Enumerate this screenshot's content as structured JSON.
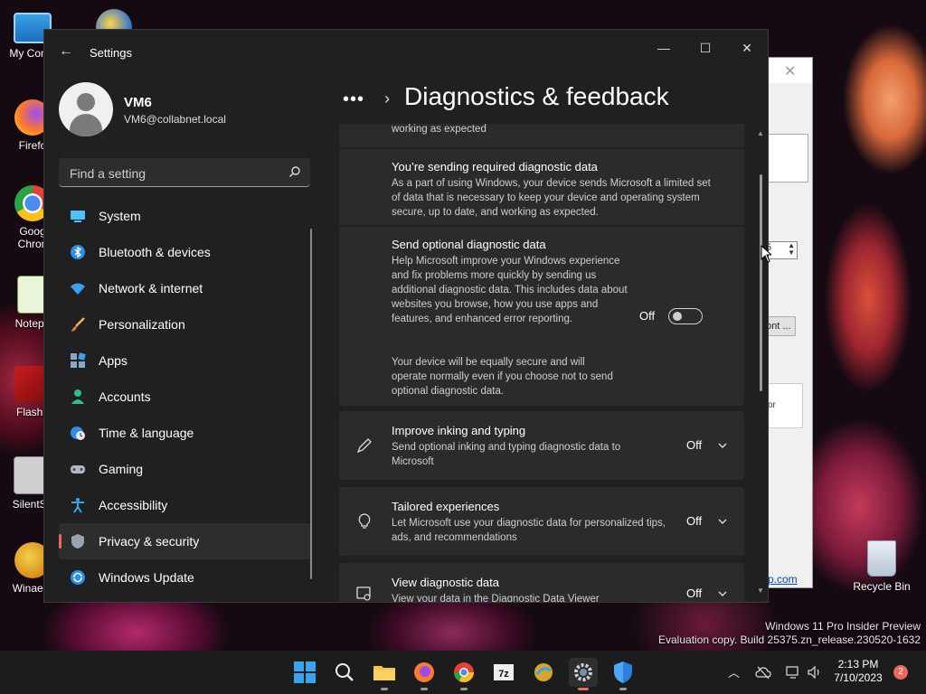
{
  "desktop": {
    "icons": [
      {
        "label": "My Comp",
        "icon": "computer-icon"
      },
      {
        "label": "Firefo",
        "icon": "firefox-icon"
      },
      {
        "label": "Goog Chron",
        "icon": "chrome-icon"
      },
      {
        "label": "Notepa",
        "icon": "notepad-icon"
      },
      {
        "label": "Flashp",
        "icon": "flash-icon"
      },
      {
        "label": "SilentSe",
        "icon": "app-icon"
      },
      {
        "label": "Winaero",
        "icon": "winaero-icon"
      },
      {
        "label": "Recycle Bin",
        "icon": "recycle-bin-icon"
      }
    ],
    "watermark_line1": "Windows 11 Pro Insider Preview",
    "watermark_line2": "Evaluation copy. Build 25375.zn_release.230520-1632"
  },
  "background_window": {
    "spin_value": "5",
    "button_label": "ont ...",
    "box_text": "or",
    "link_text": "p.com"
  },
  "settings": {
    "app_title": "Settings",
    "user": {
      "name": "VM6",
      "email": "VM6@collabnet.local"
    },
    "search": {
      "placeholder": "Find a setting"
    },
    "nav": [
      {
        "label": "System",
        "icon": "system-icon",
        "active": false
      },
      {
        "label": "Bluetooth & devices",
        "icon": "bluetooth-icon",
        "active": false
      },
      {
        "label": "Network & internet",
        "icon": "wifi-icon",
        "active": false
      },
      {
        "label": "Personalization",
        "icon": "brush-icon",
        "active": false
      },
      {
        "label": "Apps",
        "icon": "apps-icon",
        "active": false
      },
      {
        "label": "Accounts",
        "icon": "account-icon",
        "active": false
      },
      {
        "label": "Time & language",
        "icon": "globe-clock-icon",
        "active": false
      },
      {
        "label": "Gaming",
        "icon": "gamepad-icon",
        "active": false
      },
      {
        "label": "Accessibility",
        "icon": "accessibility-icon",
        "active": false
      },
      {
        "label": "Privacy & security",
        "icon": "shield-icon",
        "active": true
      },
      {
        "label": "Windows Update",
        "icon": "update-icon",
        "active": false
      }
    ],
    "breadcrumb_more": "•••",
    "page_title": "Diagnostics & feedback",
    "content": {
      "top_fragment": "working as expected",
      "required": {
        "title": "You’re sending required diagnostic data",
        "description": "As a part of using Windows, your device sends Microsoft a limited set of data that is necessary to keep your device and operating system secure, up to date, and working as expected."
      },
      "optional": {
        "title": "Send optional diagnostic data",
        "description": "Help Microsoft improve your Windows experience and fix problems more quickly by sending us additional diagnostic data. This includes data about websites you browse, how you use apps and features, and enhanced error reporting.",
        "note": "Your device will be equally secure and will operate normally even if you choose not to send optional diagnostic data.",
        "state": "Off"
      },
      "cards": [
        {
          "title": "Improve inking and typing",
          "description": "Send optional inking and typing diagnostic data to Microsoft",
          "state": "Off",
          "icon": "pen-icon"
        },
        {
          "title": "Tailored experiences",
          "description": "Let Microsoft use your diagnostic data for personalized tips, ads, and recommendations",
          "state": "Off",
          "icon": "lightbulb-icon"
        },
        {
          "title": "View diagnostic data",
          "description": "View your data in the Diagnostic Data Viewer",
          "state": "Off",
          "icon": "data-viewer-icon"
        }
      ]
    }
  },
  "taskbar": {
    "apps": [
      "start-icon",
      "search-icon",
      "file-explorer-icon",
      "firefox-icon",
      "chrome-icon",
      "7zip-icon",
      "winaero-icon",
      "settings-icon",
      "defender-icon"
    ],
    "time": "2:13 PM",
    "date": "7/10/2023",
    "notifications": "2"
  }
}
